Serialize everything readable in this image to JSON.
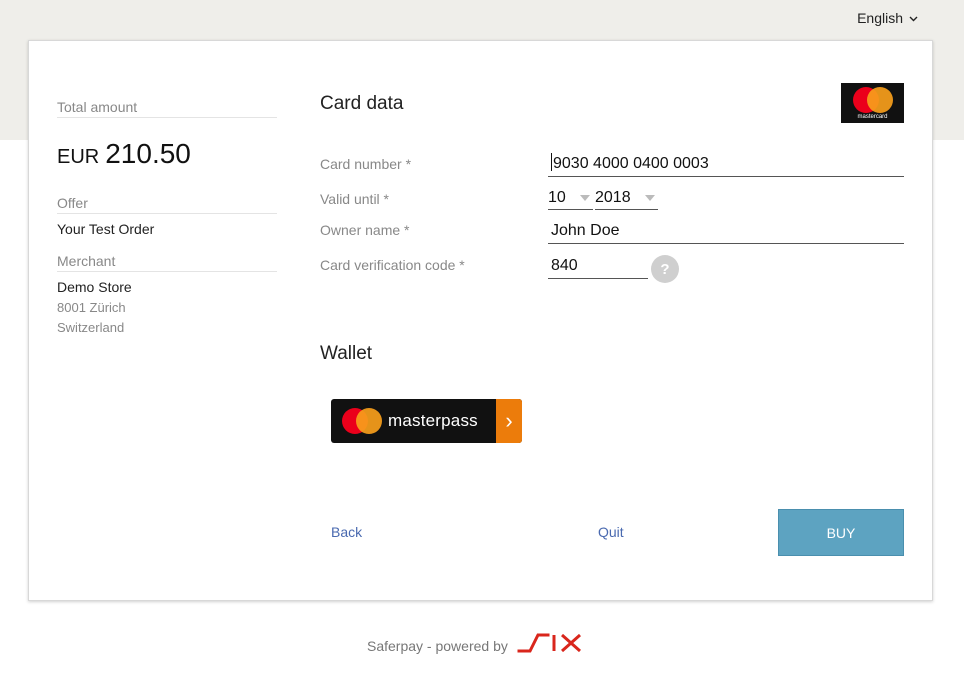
{
  "language": {
    "selected": "English",
    "chevron_icon": "chevron-down-icon"
  },
  "summary": {
    "total_label": "Total amount",
    "currency": "EUR",
    "amount": "210.50",
    "offer_label": "Offer",
    "offer_value": "Your Test Order",
    "merchant_label": "Merchant",
    "merchant_name": "Demo Store",
    "merchant_city": "8001 Zürich",
    "merchant_country": "Switzerland"
  },
  "card": {
    "title": "Card data",
    "brand_logo_text": "mastercard",
    "number_label": "Card number *",
    "number_value": "9030 4000 0400 0003",
    "valid_label": "Valid until *",
    "month_value": "10",
    "year_value": "2018",
    "owner_label": "Owner name *",
    "owner_value": "John Doe",
    "cvc_label": "Card verification code *",
    "cvc_value": "840",
    "help_symbol": "?"
  },
  "wallet": {
    "title": "Wallet",
    "button_text": "masterpass",
    "arrow": "›"
  },
  "actions": {
    "back": "Back",
    "quit": "Quit",
    "buy": "BUY"
  },
  "footer": {
    "text": "Saferpay - powered by",
    "logo": "six-logo"
  },
  "colors": {
    "accent_button": "#5da3c1",
    "link": "#4a6ab0",
    "six_red": "#d9261c",
    "masterpass_orange": "#ec7c0b"
  }
}
